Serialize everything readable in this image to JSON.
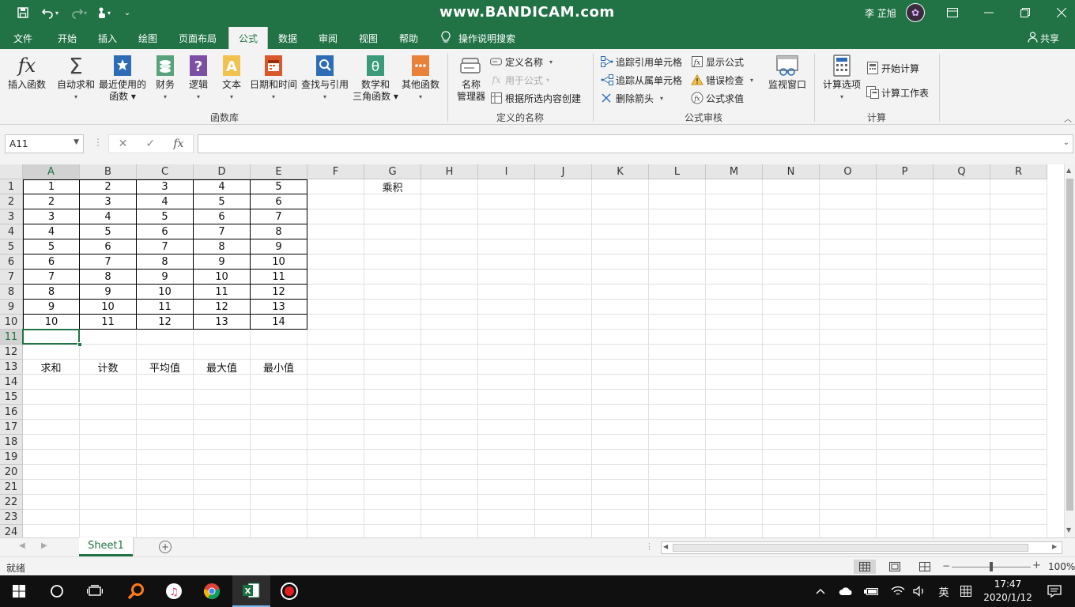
{
  "title_bar": {
    "watermark": "www.BANDICAM.com",
    "user_name": "李 芷旭",
    "window_buttons": [
      "ribbon-display-icon",
      "minimize-icon",
      "restore-icon",
      "close-icon"
    ]
  },
  "menu": {
    "tabs": [
      "文件",
      "开始",
      "插入",
      "绘图",
      "页面布局",
      "公式",
      "数据",
      "审阅",
      "视图",
      "帮助"
    ],
    "active_tab": "公式",
    "tell_me": "操作说明搜索",
    "share": "共享"
  },
  "ribbon": {
    "function_library": {
      "label": "函数库",
      "buttons": [
        {
          "line1": "插入函数",
          "line2": ""
        },
        {
          "line1": "自动求和",
          "line2": "▾"
        },
        {
          "line1": "最近使用的",
          "line2": "函数 ▾"
        },
        {
          "line1": "财务",
          "line2": "▾"
        },
        {
          "line1": "逻辑",
          "line2": "▾"
        },
        {
          "line1": "文本",
          "line2": "▾"
        },
        {
          "line1": "日期和时间",
          "line2": "▾"
        },
        {
          "line1": "查找与引用",
          "line2": "▾"
        },
        {
          "line1": "数学和",
          "line2": "三角函数 ▾"
        },
        {
          "line1": "其他函数",
          "line2": "▾"
        }
      ]
    },
    "defined_names": {
      "label": "定义的名称",
      "name_manager": {
        "line1": "名称",
        "line2": "管理器"
      },
      "define_name": "定义名称",
      "use_in_formula": "用于公式",
      "create_from_selection": "根据所选内容创建"
    },
    "formula_auditing": {
      "label": "公式审核",
      "trace_precedents": "追踪引用单元格",
      "trace_dependents": "追踪从属单元格",
      "remove_arrows": "删除箭头",
      "show_formulas": "显示公式",
      "error_checking": "错误检查",
      "evaluate_formula": "公式求值",
      "watch_window": "监视窗口"
    },
    "calculation": {
      "label": "计算",
      "calc_options": "计算选项",
      "calc_now": "开始计算",
      "calc_sheet": "计算工作表"
    }
  },
  "formula_bar": {
    "name_box": "A11",
    "cancel_glyph": "✕",
    "enter_glyph": "✓",
    "fx_glyph": "fx",
    "formula": ""
  },
  "grid": {
    "columns": [
      "A",
      "B",
      "C",
      "D",
      "E",
      "F",
      "G",
      "H",
      "I",
      "J",
      "K",
      "L",
      "M",
      "N",
      "O",
      "P",
      "Q",
      "R"
    ],
    "rows": [
      "1",
      "2",
      "3",
      "4",
      "5",
      "6",
      "7",
      "8",
      "9",
      "10",
      "11",
      "12",
      "13",
      "14",
      "15",
      "16",
      "17",
      "18",
      "19",
      "20",
      "21",
      "22",
      "23",
      "24"
    ],
    "selected_cell": "A11",
    "bordered_range": "A1:E10",
    "cells": {
      "A1": "1",
      "B1": "2",
      "C1": "3",
      "D1": "4",
      "E1": "5",
      "G1": "乘积",
      "A2": "2",
      "B2": "3",
      "C2": "4",
      "D2": "5",
      "E2": "6",
      "A3": "3",
      "B3": "4",
      "C3": "5",
      "D3": "6",
      "E3": "7",
      "A4": "4",
      "B4": "5",
      "C4": "6",
      "D4": "7",
      "E4": "8",
      "A5": "5",
      "B5": "6",
      "C5": "7",
      "D5": "8",
      "E5": "9",
      "A6": "6",
      "B6": "7",
      "C6": "8",
      "D6": "9",
      "E6": "10",
      "A7": "7",
      "B7": "8",
      "C7": "9",
      "D7": "10",
      "E7": "11",
      "A8": "8",
      "B8": "9",
      "C8": "10",
      "D8": "11",
      "E8": "12",
      "A9": "9",
      "B9": "10",
      "C9": "11",
      "D9": "12",
      "E9": "13",
      "A10": "10",
      "B10": "11",
      "C10": "12",
      "D10": "13",
      "E10": "14",
      "A13": "求和",
      "B13": "计数",
      "C13": "平均值",
      "D13": "最大值",
      "E13": "最小值"
    }
  },
  "sheet_tabs": {
    "tabs": [
      "Sheet1"
    ],
    "active": "Sheet1"
  },
  "status_bar": {
    "status": "就绪",
    "zoom": "100%",
    "zoom_fraction": 0.5
  },
  "taskbar": {
    "time": "17:47",
    "date": "2020/1/12",
    "ime": "英",
    "apps": [
      "windows-start-icon",
      "search-icon",
      "task-view-icon",
      "search-app-icon",
      "itunes-icon",
      "chrome-icon",
      "excel-icon",
      "bandicam-icon"
    ]
  },
  "colors": {
    "excel_green": "#217346",
    "ribbon_bg": "#f3f3f3",
    "header_bg": "#e6e6e6",
    "taskbar_bg": "#101010"
  }
}
